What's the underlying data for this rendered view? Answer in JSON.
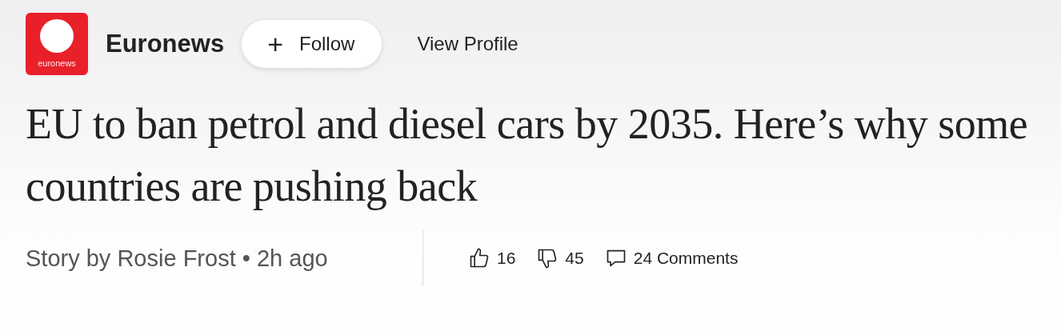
{
  "publisher": {
    "logo_text": "euronews",
    "name": "Euronews",
    "follow_button": {
      "icon": "+",
      "label": "Follow"
    },
    "view_profile": "View Profile"
  },
  "headline": "EU to ban petrol and diesel cars by 2035. Here’s why some countries are pushing back",
  "byline": "Story by Rosie Frost • 2h ago",
  "reactions": [
    {
      "kind": "like",
      "count": "16"
    },
    {
      "kind": "dislike",
      "count": "45"
    },
    {
      "kind": "comments",
      "count": "24 Comments"
    }
  ]
}
